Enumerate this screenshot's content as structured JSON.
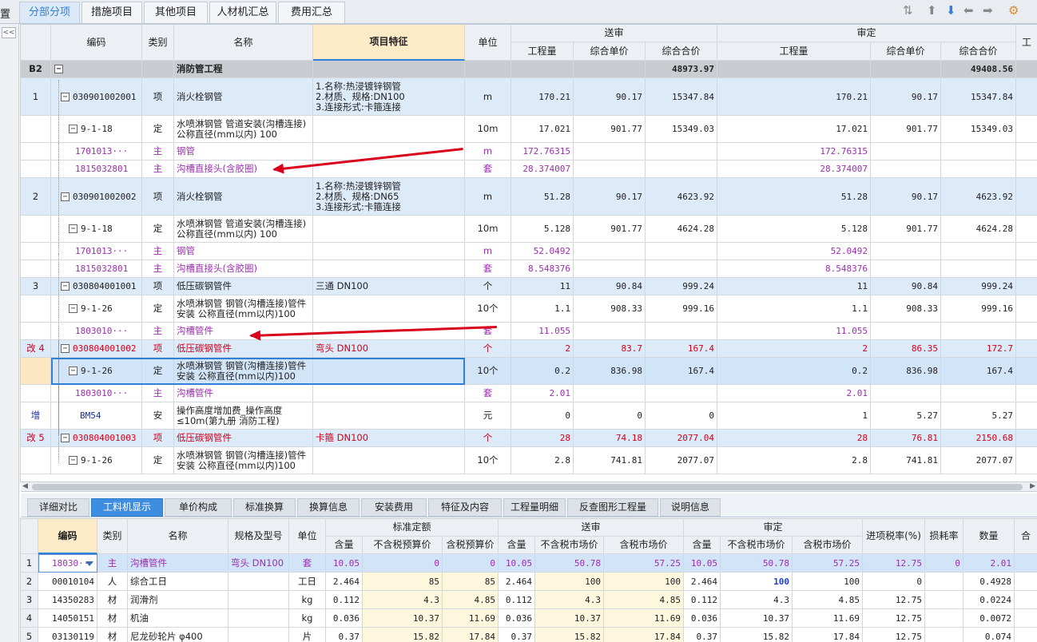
{
  "top_tabs": [
    {
      "label": "分部分项",
      "active": true
    },
    {
      "label": "措施项目"
    },
    {
      "label": "其他项目"
    },
    {
      "label": "人材机汇总"
    },
    {
      "label": "费用汇总"
    }
  ],
  "left_edge_char": "置",
  "collapse_glyph": "<<",
  "toolbar_icons": [
    "sort-icon",
    "move-up-icon",
    "move-down-icon",
    "move-left-icon",
    "move-right-icon",
    "settings-icon"
  ],
  "toolbar_glyphs": {
    "sort": "⇅",
    "up": "⬆",
    "down": "⬇",
    "left": "⬅",
    "right": "➡",
    "settings": "⚙"
  },
  "main_headers": {
    "code": "编码",
    "type": "类别",
    "name": "名称",
    "feature": "项目特征",
    "unit": "单位",
    "group1": "送审",
    "group2": "审定",
    "qty": "工程量",
    "unit_price": "综合单价",
    "total_price": "综合合价",
    "extra": "工"
  },
  "main_rows": [
    {
      "kind": "section",
      "seq": "B2",
      "code": "",
      "type": "",
      "name": "消防管工程",
      "feature": "",
      "unit": "",
      "q1": "",
      "p1": "",
      "t1": "48973.97",
      "q2": "",
      "p2": "",
      "t2": "49408.56"
    },
    {
      "kind": "item",
      "seq": "1",
      "code": "030901002001",
      "type": "项",
      "name": "消火栓钢管",
      "feature": "1.名称:热浸镀锌钢管\n2.材质、规格:DN100\n3.连接形式:卡箍连接",
      "unit": "m",
      "q1": "170.21",
      "p1": "90.17",
      "t1": "15347.84",
      "q2": "170.21",
      "p2": "90.17",
      "t2": "15347.84"
    },
    {
      "kind": "quota",
      "seq": "",
      "code": "9-1-18",
      "type": "定",
      "name": "水喷淋钢管 管道安装(沟槽连接) 公称直径(mm以内) 100",
      "feature": "",
      "unit": "10m",
      "q1": "17.021",
      "p1": "901.77",
      "t1": "15349.03",
      "q2": "17.021",
      "p2": "901.77",
      "t2": "15349.03"
    },
    {
      "kind": "main",
      "seq": "",
      "code": "1701013···",
      "type": "主",
      "name": "钢管",
      "feature": "",
      "unit": "m",
      "q1": "172.76315",
      "p1": "",
      "t1": "",
      "q2": "172.76315",
      "p2": "",
      "t2": ""
    },
    {
      "kind": "main",
      "seq": "",
      "code": "1815032801",
      "type": "主",
      "name": "沟槽直接头(含胶圈)",
      "feature": "",
      "unit": "套",
      "q1": "28.374007",
      "p1": "",
      "t1": "",
      "q2": "28.374007",
      "p2": "",
      "t2": ""
    },
    {
      "kind": "item",
      "seq": "2",
      "code": "030901002002",
      "type": "项",
      "name": "消火栓钢管",
      "feature": "1.名称:热浸镀锌钢管\n2.材质、规格:DN65\n3.连接形式:卡箍连接",
      "unit": "m",
      "q1": "51.28",
      "p1": "90.17",
      "t1": "4623.92",
      "q2": "51.28",
      "p2": "90.17",
      "t2": "4623.92"
    },
    {
      "kind": "quota",
      "seq": "",
      "code": "9-1-18",
      "type": "定",
      "name": "水喷淋钢管 管道安装(沟槽连接) 公称直径(mm以内) 100",
      "feature": "",
      "unit": "10m",
      "q1": "5.128",
      "p1": "901.77",
      "t1": "4624.28",
      "q2": "5.128",
      "p2": "901.77",
      "t2": "4624.28"
    },
    {
      "kind": "main",
      "seq": "",
      "code": "1701013···",
      "type": "主",
      "name": "钢管",
      "feature": "",
      "unit": "m",
      "q1": "52.0492",
      "p1": "",
      "t1": "",
      "q2": "52.0492",
      "p2": "",
      "t2": ""
    },
    {
      "kind": "main",
      "seq": "",
      "code": "1815032801",
      "type": "主",
      "name": "沟槽直接头(含胶圈)",
      "feature": "",
      "unit": "套",
      "q1": "8.548376",
      "p1": "",
      "t1": "",
      "q2": "8.548376",
      "p2": "",
      "t2": ""
    },
    {
      "kind": "item",
      "seq": "3",
      "code": "030804001001",
      "type": "项",
      "name": "低压碳钢管件",
      "feature": "三通 DN100",
      "unit": "个",
      "q1": "11",
      "p1": "90.84",
      "t1": "999.24",
      "q2": "11",
      "p2": "90.84",
      "t2": "999.24"
    },
    {
      "kind": "quota",
      "seq": "",
      "code": "9-1-26",
      "type": "定",
      "name": "水喷淋钢管 钢管(沟槽连接)管件安装 公称直径(mm以内)100",
      "feature": "",
      "unit": "10个",
      "q1": "1.1",
      "p1": "908.33",
      "t1": "999.16",
      "q2": "1.1",
      "p2": "908.33",
      "t2": "999.16"
    },
    {
      "kind": "main",
      "seq": "",
      "code": "1803010···",
      "type": "主",
      "name": "沟槽管件",
      "feature": "",
      "unit": "套",
      "q1": "11.055",
      "p1": "",
      "t1": "",
      "q2": "11.055",
      "p2": "",
      "t2": ""
    },
    {
      "kind": "changed",
      "seq": "改 4",
      "code": "030804001002",
      "type": "项",
      "name": "低压碳钢管件",
      "feature": "弯头 DN100",
      "unit": "个",
      "q1": "2",
      "p1": "83.7",
      "t1": "167.4",
      "q2": "2",
      "p2": "86.35",
      "t2": "172.7"
    },
    {
      "kind": "quota-sel",
      "seq": "",
      "code": "9-1-26",
      "type": "定",
      "name": "水喷淋钢管 钢管(沟槽连接)管件安装 公称直径(mm以内)100",
      "feature": "",
      "unit": "10个",
      "q1": "0.2",
      "p1": "836.98",
      "t1": "167.4",
      "q2": "0.2",
      "p2": "836.98",
      "t2": "167.4"
    },
    {
      "kind": "main",
      "seq": "",
      "code": "1803010···",
      "type": "主",
      "name": "沟槽管件",
      "feature": "",
      "unit": "套",
      "q1": "2.01",
      "p1": "",
      "t1": "",
      "q2": "2.01",
      "p2": "",
      "t2": ""
    },
    {
      "kind": "added",
      "seq": "增",
      "code": "BM54",
      "type": "安",
      "name": "操作高度增加费_操作高度≤10m(第九册 消防工程)",
      "feature": "",
      "unit": "元",
      "q1": "0",
      "p1": "0",
      "t1": "0",
      "q2": "1",
      "p2": "5.27",
      "t2": "5.27"
    },
    {
      "kind": "changed",
      "seq": "改 5",
      "code": "030804001003",
      "type": "项",
      "name": "低压碳钢管件",
      "feature": "卡箍 DN100",
      "unit": "个",
      "q1": "28",
      "p1": "74.18",
      "t1": "2077.04",
      "q2": "28",
      "p2": "76.81",
      "t2": "2150.68"
    },
    {
      "kind": "quota",
      "seq": "",
      "code": "9-1-26",
      "type": "定",
      "name": "水喷淋钢管 钢管(沟槽连接)管件安装 公称直径(mm以内)100",
      "feature": "",
      "unit": "10个",
      "q1": "2.8",
      "p1": "741.81",
      "t1": "2077.07",
      "q2": "2.8",
      "p2": "741.81",
      "t2": "2077.07"
    }
  ],
  "bottom_tabs": [
    {
      "label": "详细对比"
    },
    {
      "label": "工料机显示",
      "active": true
    },
    {
      "label": "单价构成"
    },
    {
      "label": "标准换算"
    },
    {
      "label": "换算信息"
    },
    {
      "label": "安装费用"
    },
    {
      "label": "特征及内容"
    },
    {
      "label": "工程量明细"
    },
    {
      "label": "反查图形工程量"
    },
    {
      "label": "说明信息"
    }
  ],
  "detail_headers": {
    "code": "编码",
    "type": "类别",
    "name": "名称",
    "spec": "规格及型号",
    "unit": "单位",
    "g_std": "标准定额",
    "g_send": "送审",
    "g_final": "审定",
    "qty": "含量",
    "std_excl": "不含税预算价",
    "std_incl": "含税预算价",
    "mkt_excl": "不含税市场价",
    "mkt_incl": "含税市场价",
    "tax": "进项税率(%)",
    "loss": "损耗率",
    "amount": "数量",
    "extra": "合"
  },
  "detail_rows": [
    {
      "n": "1",
      "code": "18030···",
      "type": "主",
      "name": "沟槽管件",
      "spec": "弯头 DN100",
      "unit": "套",
      "c1": "10.05",
      "c2": "0",
      "c3": "0",
      "c4": "10.05",
      "c5": "50.78",
      "c6": "57.25",
      "c7": "10.05",
      "c8": "50.78",
      "c9": "57.25",
      "c10": "12.75",
      "c11": "0",
      "c12": "2.01"
    },
    {
      "n": "2",
      "code": "00010104",
      "type": "人",
      "name": "综合工日",
      "spec": "",
      "unit": "工日",
      "c1": "2.464",
      "c2": "85",
      "c3": "85",
      "c4": "2.464",
      "c5": "100",
      "c6": "100",
      "c7": "2.464",
      "c8": "100",
      "c9": "100",
      "c10": "0",
      "c11": "",
      "c12": "0.4928"
    },
    {
      "n": "3",
      "code": "14350283",
      "type": "材",
      "name": "润滑剂",
      "spec": "",
      "unit": "kg",
      "c1": "0.112",
      "c2": "4.3",
      "c3": "4.85",
      "c4": "0.112",
      "c5": "4.3",
      "c6": "4.85",
      "c7": "0.112",
      "c8": "4.3",
      "c9": "4.85",
      "c10": "12.75",
      "c11": "",
      "c12": "0.0224"
    },
    {
      "n": "4",
      "code": "14050151",
      "type": "材",
      "name": "机油",
      "spec": "",
      "unit": "kg",
      "c1": "0.036",
      "c2": "10.37",
      "c3": "11.69",
      "c4": "0.036",
      "c5": "10.37",
      "c6": "11.69",
      "c7": "0.036",
      "c8": "10.37",
      "c9": "11.69",
      "c10": "12.75",
      "c11": "",
      "c12": "0.0072"
    },
    {
      "n": "5",
      "code": "03130119",
      "type": "材",
      "name": "尼龙砂轮片 φ400",
      "spec": "",
      "unit": "片",
      "c1": "0.37",
      "c2": "15.82",
      "c3": "17.84",
      "c4": "0.37",
      "c5": "15.82",
      "c6": "17.84",
      "c7": "0.37",
      "c8": "15.82",
      "c9": "17.84",
      "c10": "12.75",
      "c11": "",
      "c12": "0.074"
    }
  ],
  "colors": {
    "accent": "#2f80d9",
    "purple": "#9b2fae",
    "red": "#d0021b",
    "arrow": "#d9001b"
  }
}
